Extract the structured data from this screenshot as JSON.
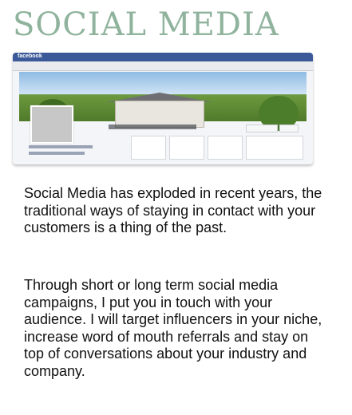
{
  "heading": "SOCIAL MEDIA",
  "screenshot": {
    "logo_text": "facebook",
    "page_name": "Hoth & Dimondale Agency"
  },
  "paragraphs": [
    "Social Media has exploded in recent years, the traditional ways of staying in contact with your customers is a thing of the past.",
    "Through short or long term social media campaigns, I put you in touch with your audience. I will target influencers in your niche, increase word of mouth referrals and stay on top of conversations about your industry and company."
  ],
  "colors": {
    "heading": "#8fb39c",
    "facebook_blue": "#3b5998",
    "text": "#111111"
  }
}
